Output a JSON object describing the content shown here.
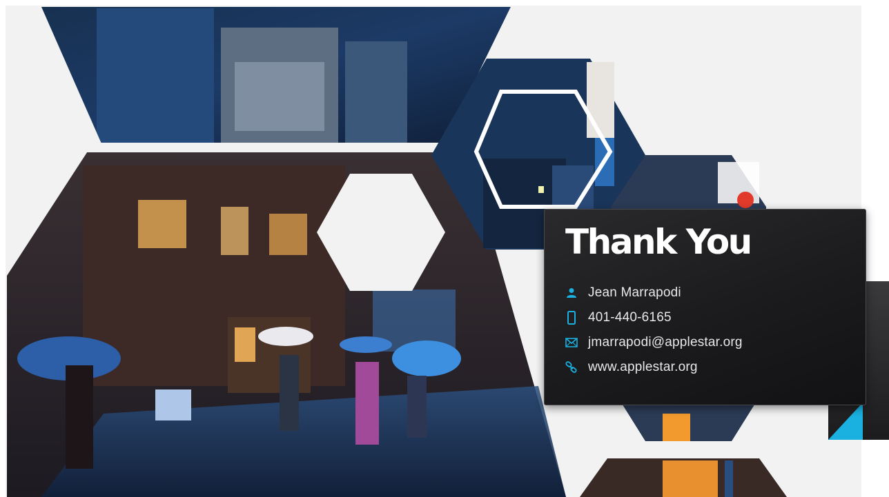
{
  "slide": {
    "title": "Thank You",
    "contact": {
      "name": "Jean Marrapodi",
      "phone": "401-440-6165",
      "email": "jmarrapodi@applestar.org",
      "website": "www.applestar.org"
    },
    "icons": {
      "name": "person-icon",
      "phone": "mobile-phone-icon",
      "email": "envelope-icon",
      "website": "link-icon"
    },
    "colors": {
      "accent": "#1ab0e0",
      "card": "#1e1e20",
      "slide_background": "#f2f2f2",
      "photo_night_blue": "#1c3a66",
      "photo_dark": "#2a2324"
    }
  }
}
